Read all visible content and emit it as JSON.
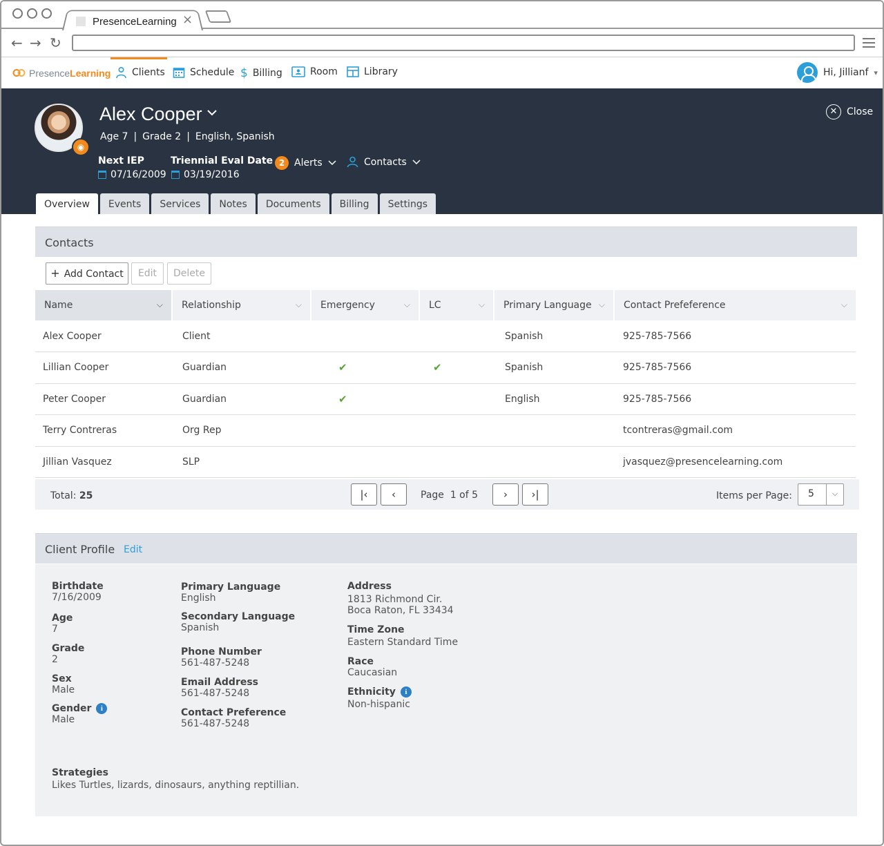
{
  "browser": {
    "tab_title": "PresenceLearning",
    "tab_close": "×"
  },
  "nav": {
    "logo": {
      "part1": "Presence",
      "part2": "Learning"
    },
    "items": [
      {
        "label": "Clients",
        "icon": "clients-icon"
      },
      {
        "label": "Schedule",
        "icon": "calendar-icon"
      },
      {
        "label": "Billing",
        "icon": "dollar-icon"
      },
      {
        "label": "Room",
        "icon": "room-icon"
      },
      {
        "label": "Library",
        "icon": "library-icon"
      }
    ],
    "user_greeting": "Hi, Jillianf"
  },
  "client": {
    "name": "Alex Cooper",
    "age": "Age 7",
    "grade": "Grade 2",
    "languages": "English, Spanish",
    "next_iep_label": "Next IEP",
    "next_iep": "07/16/2009",
    "triennial_label": "Triennial Eval Date",
    "triennial": "03/19/2016",
    "alerts_count": "2",
    "alerts_label": "Alerts",
    "contacts_label": "Contacts",
    "close_label": "Close"
  },
  "tabs": [
    "Overview",
    "Events",
    "Services",
    "Notes",
    "Documents",
    "Billing",
    "Settings"
  ],
  "contacts": {
    "title": "Contacts",
    "add_label": "Add Contact",
    "edit_label": "Edit",
    "delete_label": "Delete",
    "columns": [
      "Name",
      "Relationship",
      "Emergency",
      "LC",
      "Primary Language",
      "Contact Prefeference"
    ],
    "rows": [
      {
        "name": "Alex Cooper",
        "relationship": "Client",
        "emergency": false,
        "lc": false,
        "language": "Spanish",
        "contact": "925-785-7566"
      },
      {
        "name": "Lillian Cooper",
        "relationship": "Guardian",
        "emergency": true,
        "lc": true,
        "language": "Spanish",
        "contact": "925-785-7566"
      },
      {
        "name": "Peter Cooper",
        "relationship": "Guardian",
        "emergency": true,
        "lc": false,
        "language": "English",
        "contact": "925-785-7566"
      },
      {
        "name": "Terry Contreras",
        "relationship": "Org Rep",
        "emergency": false,
        "lc": false,
        "language": "",
        "contact": "tcontreras@gmail.com"
      },
      {
        "name": "Jillian Vasquez",
        "relationship": "SLP",
        "emergency": false,
        "lc": false,
        "language": "",
        "contact": "jvasquez@presencelearning.com"
      }
    ],
    "check_glyph": "✔",
    "total_label": "Total:",
    "total": "25",
    "page_label": "Page",
    "page_of": "1 of 5",
    "items_per_page_label": "Items per Page:",
    "items_per_page": "5"
  },
  "profile": {
    "title": "Client Profile",
    "edit_label": "Edit",
    "birthdate_label": "Birthdate",
    "birthdate": "7/16/2009",
    "age_label": "Age",
    "age": "7",
    "grade_label": "Grade",
    "grade": "2",
    "sex_label": "Sex",
    "sex": "Male",
    "gender_label": "Gender",
    "gender": "Male",
    "primary_language_label": "Primary Language",
    "primary_language": "English",
    "secondary_language_label": "Secondary Language",
    "secondary_language": "Spanish",
    "phone_label": "Phone Number",
    "phone": "561-487-5248",
    "email_label": "Email Address",
    "email": "561-487-5248",
    "contact_pref_label": "Contact Preference",
    "contact_pref": "561-487-5248",
    "address_label": "Address",
    "address_line1": "1813 Richmond Cir.",
    "address_line2": "Boca Raton, FL 33434",
    "timezone_label": "Time Zone",
    "timezone": "Eastern Standard Time",
    "race_label": "Race",
    "race": "Caucasian",
    "ethnicity_label": "Ethnicity",
    "ethnicity": "Non-hispanic",
    "strategies_label": "Strategies",
    "strategies": "Likes Turtles, lizards, dinosaurs, anything reptillian."
  },
  "colors": {
    "accent": "#2d9fd8",
    "brand_orange": "#f28a1d",
    "header_bg": "#293342",
    "check_green": "#5aa23a"
  }
}
